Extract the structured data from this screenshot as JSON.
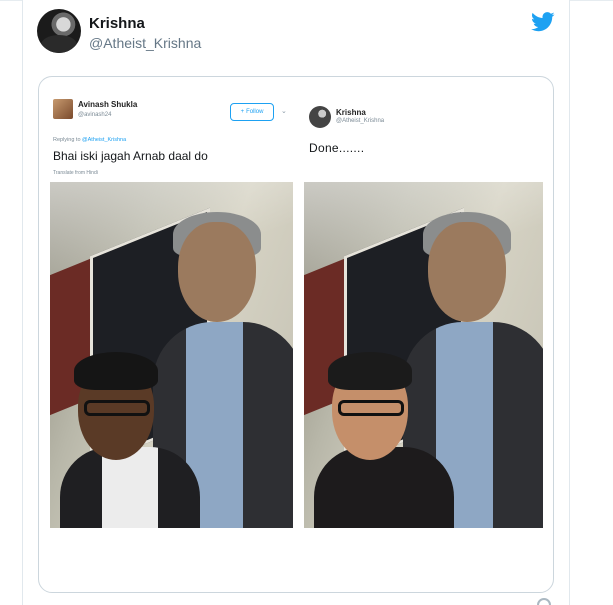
{
  "tweet": {
    "author_name": "Krishna",
    "author_handle": "@Atheist_Krishna"
  },
  "media": {
    "left": {
      "name": "Avinash Shukla",
      "handle": "@avinash24",
      "follow_label": "Follow",
      "caret": "⌄",
      "replying_prefix": "Replying to ",
      "replying_handle": "@Atheist_Krishna",
      "text": "Bhai iski jagah Arnab daal do",
      "translate": "Translate from Hindi"
    },
    "right": {
      "name": "Krishna",
      "handle": "@Atheist_Krishna",
      "text": "Done......."
    }
  },
  "colors": {
    "twitter_blue": "#1da1f2",
    "border": "#ccd6dd",
    "muted": "#657786"
  }
}
